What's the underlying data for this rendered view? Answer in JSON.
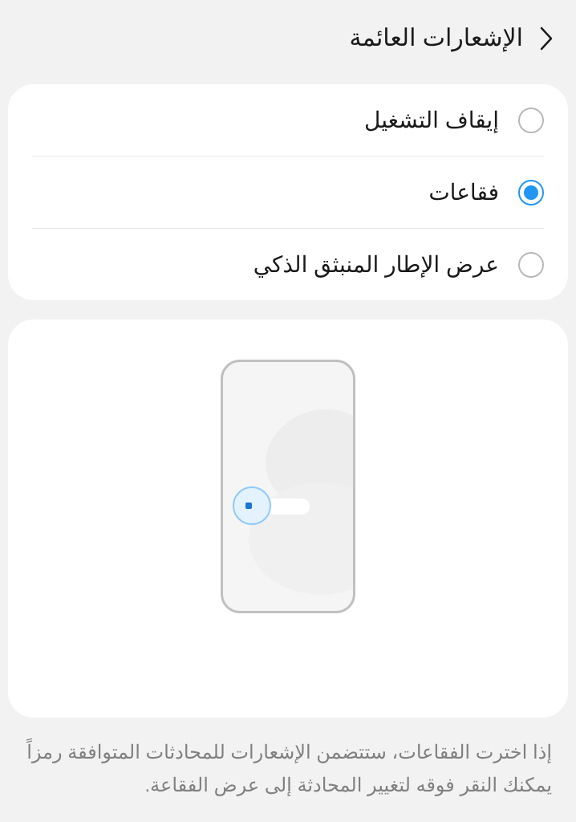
{
  "header": {
    "title": "الإشعارات العائمة"
  },
  "options": {
    "off": "إيقاف التشغيل",
    "bubbles": "فقاعات",
    "smart_popup": "عرض الإطار المنبثق الذكي",
    "selected": "bubbles"
  },
  "description": "إذا اخترت الفقاعات، ستتضمن الإشعارات للمحادثات المتوافقة رمزاً يمكنك النقر فوقه لتغيير المحادثة إلى عرض الفقاعة."
}
